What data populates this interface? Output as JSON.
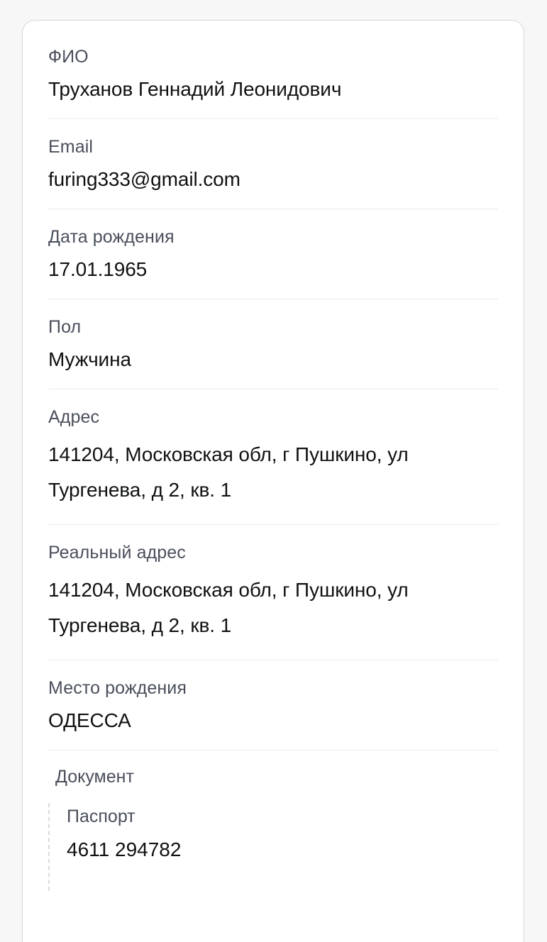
{
  "card": {
    "fields": [
      {
        "label": "ФИО",
        "value": "Труханов Геннадий Леонидович"
      },
      {
        "label": "Email",
        "value": "furing333@gmail.com"
      },
      {
        "label": "Дата рождения",
        "value": "17.01.1965"
      },
      {
        "label": "Пол",
        "value": "Мужчина"
      },
      {
        "label": "Адрес",
        "value": "141204, Московская обл, г Пушкино, ул Тургенева, д 2, кв. 1"
      },
      {
        "label": "Реальный адрес",
        "value": "141204, Московская обл, г Пушкино, ул Тургенева, д 2, кв. 1"
      },
      {
        "label": "Место рождения",
        "value": "ОДЕССА"
      }
    ],
    "document": {
      "label": "Документ",
      "sub_label": "Паспорт",
      "sub_value": "4611 294782"
    }
  },
  "colors": {
    "page_background": "#f7f7f8",
    "card_background": "#ffffff",
    "card_border": "#d6d6da",
    "divider": "#ececed",
    "label_text": "#4a4f5c",
    "value_text": "#101113",
    "dashed_guide": "#dcdcdf"
  }
}
